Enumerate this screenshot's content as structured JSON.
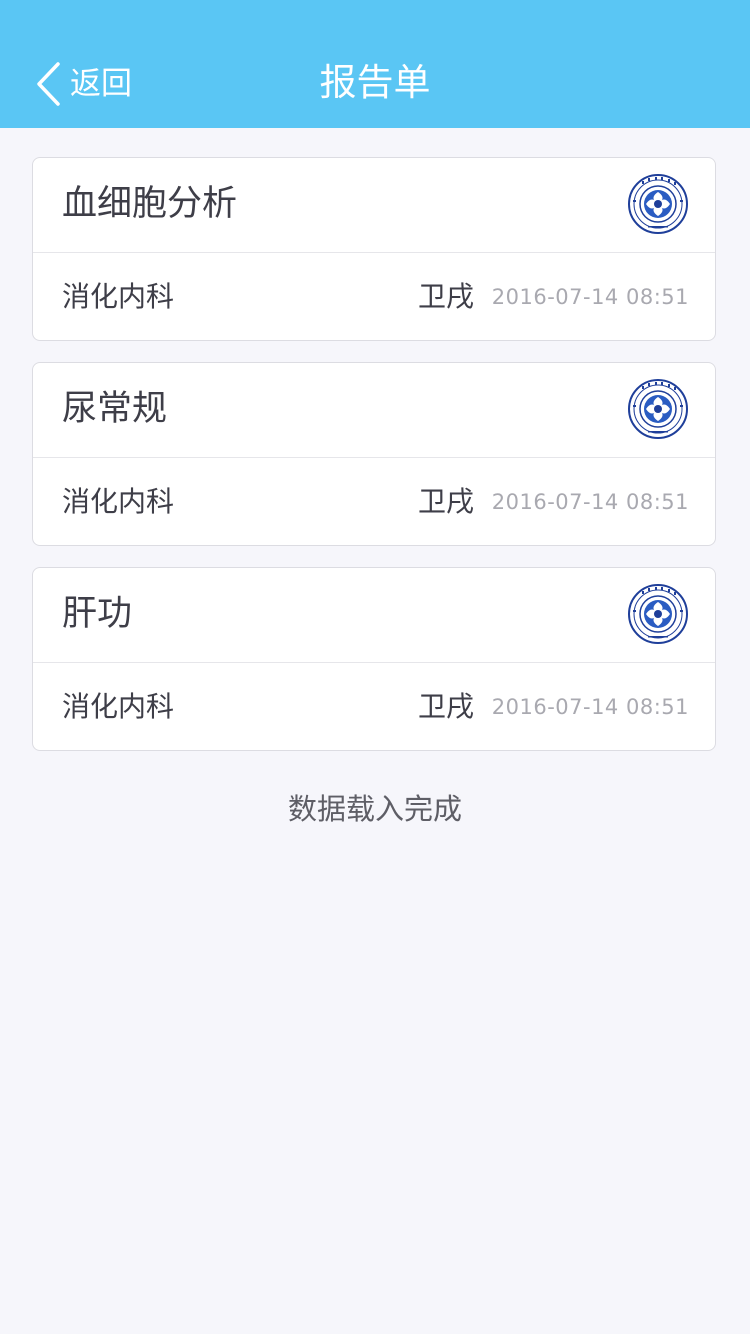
{
  "nav": {
    "back_label": "返回",
    "title": "报告单",
    "background": "#5ac6f4"
  },
  "reports": [
    {
      "title": "血细胞分析",
      "department": "消化内科",
      "doctor": "卫戌",
      "datetime": "2016-07-14 08:51",
      "icon": "hospital-seal-icon"
    },
    {
      "title": "尿常规",
      "department": "消化内科",
      "doctor": "卫戌",
      "datetime": "2016-07-14 08:51",
      "icon": "hospital-seal-icon"
    },
    {
      "title": "肝功",
      "department": "消化内科",
      "doctor": "卫戌",
      "datetime": "2016-07-14 08:51",
      "icon": "hospital-seal-icon"
    }
  ],
  "status_text": "数据载入完成"
}
